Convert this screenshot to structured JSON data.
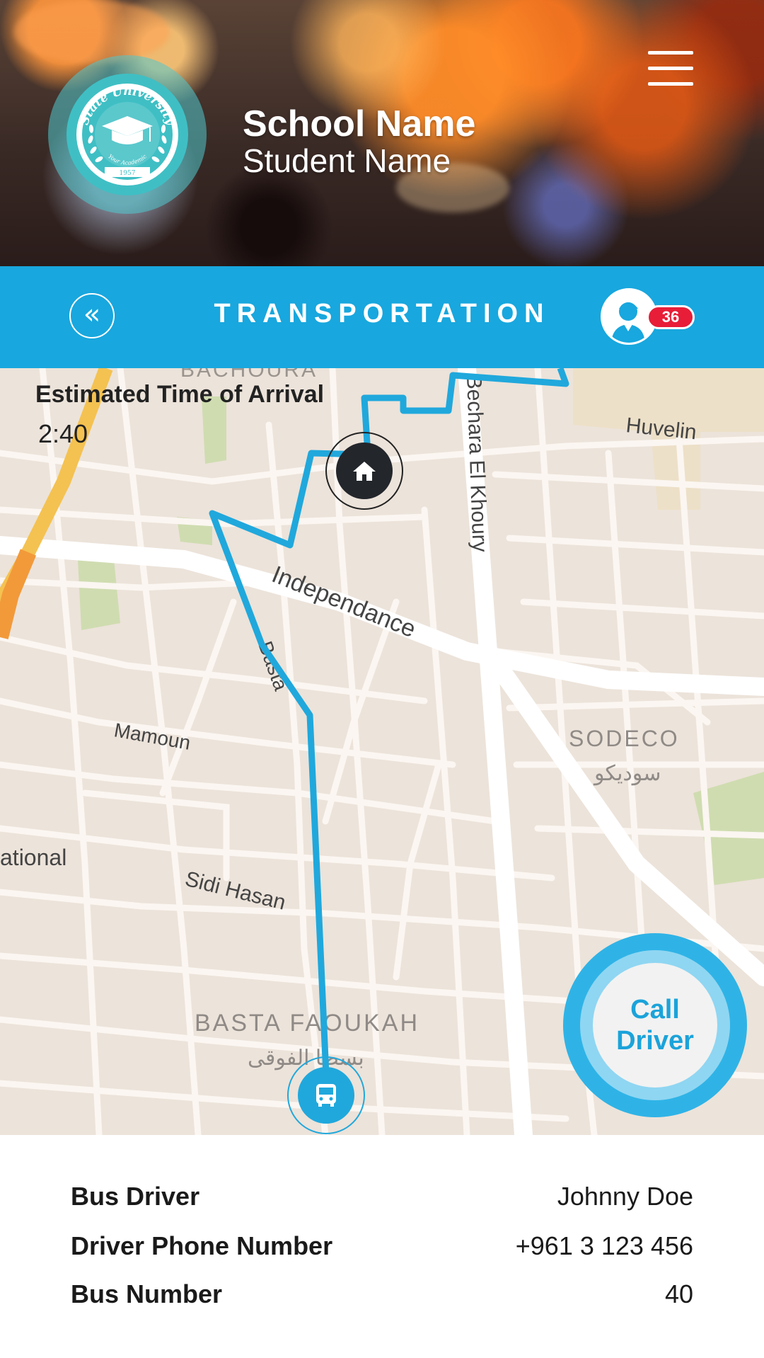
{
  "header": {
    "school_name": "School Name",
    "student_name": "Student Name",
    "logo_text": {
      "top": "State University",
      "bottom": "Your Academic",
      "year": "1957"
    },
    "menu_icon": "hamburger-menu-icon"
  },
  "titlebar": {
    "back_icon": "double-chevron-left-icon",
    "back_glyph": "«",
    "title": "TRANSPORTATION",
    "profile_icon": "user-avatar-icon",
    "notification_count": "36"
  },
  "map": {
    "eta_label": "Estimated Time of Arrival",
    "eta_value": "2:40",
    "labels": {
      "bachoura": "BACHOURA",
      "bechara": "Bechara El Khoury",
      "huvelin": "Huvelin",
      "independance": "Independance",
      "basta": "Basta",
      "mamoun": "Mamoun",
      "sodeco": "SODECO",
      "sodeco_ar": "سوديكو",
      "national": "ational",
      "sidi_hasan": "Sidi Hasan",
      "basta_faoukah": "BASTA FAOUKAH",
      "basta_faoukah_ar": "بسطا الفوقى"
    },
    "home_marker_icon": "home-icon",
    "bus_marker_icon": "bus-icon",
    "route_color": "#20a8dc"
  },
  "call_button": {
    "line1": "Call",
    "line2": "Driver"
  },
  "info": {
    "rows": [
      {
        "label": "Bus Driver",
        "value": "Johnny Doe"
      },
      {
        "label": "Driver Phone Number",
        "value": "+961 3 123 456"
      },
      {
        "label": "Bus Number",
        "value": "40"
      }
    ]
  },
  "colors": {
    "accent": "#18a7de",
    "badge": "#e81d38",
    "map_bg": "#ece3da"
  }
}
